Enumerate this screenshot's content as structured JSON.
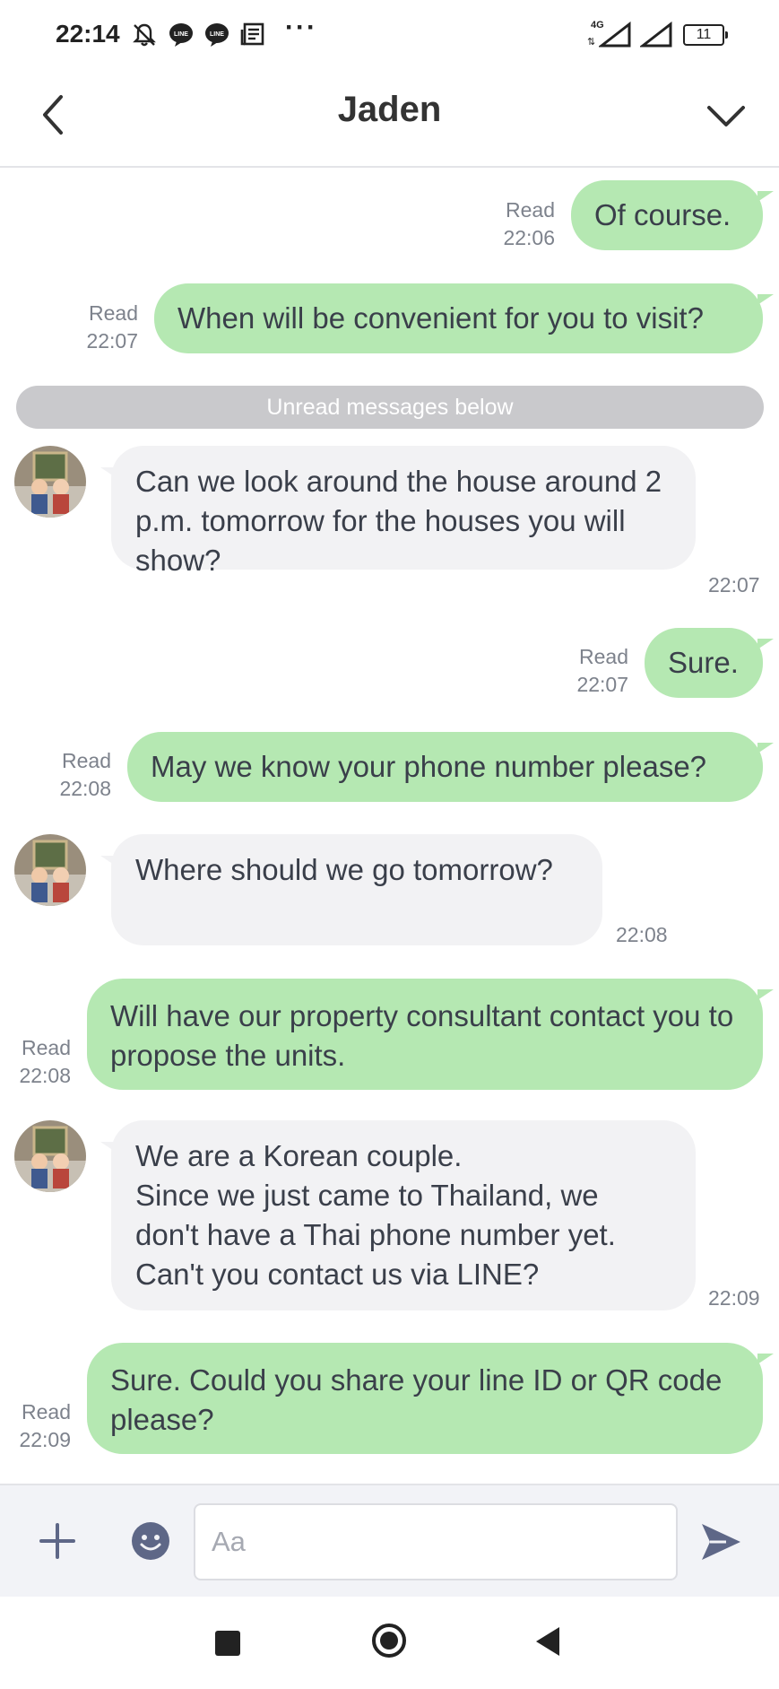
{
  "status_bar": {
    "time": "22:14",
    "icons": [
      "mute-bell-icon",
      "line-icon",
      "line-icon",
      "news-icon",
      "more-icon"
    ],
    "more_label": "···",
    "network": "4G",
    "battery": "11"
  },
  "header": {
    "title": "Jaden",
    "back_icon": "chevron-left-icon",
    "menu_icon": "chevron-down-icon"
  },
  "unread_divider": "Unread messages below",
  "messages": [
    {
      "dir": "out",
      "text": "Of course.",
      "status": "Read",
      "time": "22:06"
    },
    {
      "dir": "out",
      "text": "When will be convenient for you to visit?",
      "status": "Read",
      "time": "22:07"
    },
    {
      "dir": "in",
      "text": "Can we look around the house around 2 p.m. tomorrow for the houses you will show?",
      "time": "22:07"
    },
    {
      "dir": "out",
      "text": "Sure.",
      "status": "Read",
      "time": "22:07"
    },
    {
      "dir": "out",
      "text": "May we know your phone number please?",
      "status": "Read",
      "time": "22:08"
    },
    {
      "dir": "in",
      "text": "Where should we go tomorrow?",
      "time": "22:08"
    },
    {
      "dir": "out",
      "text": "Will have our property consultant contact you to propose the units.",
      "status": "Read",
      "time": "22:08"
    },
    {
      "dir": "in",
      "lines": [
        "We are a Korean couple.",
        "Since we just came to Thailand, we",
        "don't have a Thai phone number yet.",
        "Can't you contact us via LINE?"
      ],
      "time": "22:09"
    },
    {
      "dir": "out",
      "text": "Sure. Could you share your line ID or QR code please?",
      "status": "Read",
      "time": "22:09"
    }
  ],
  "input_bar": {
    "placeholder": "Aa",
    "plus_icon": "plus-icon",
    "emoji_icon": "emoji-icon",
    "send_icon": "send-icon"
  },
  "nav_bar": {
    "icons": [
      "recents-icon",
      "home-icon",
      "back-icon"
    ]
  },
  "colors": {
    "outgoing_bubble": "#b5e8b2",
    "incoming_bubble": "#f2f2f4",
    "divider": "#c9c9cc",
    "meta_text": "#7d828c"
  }
}
